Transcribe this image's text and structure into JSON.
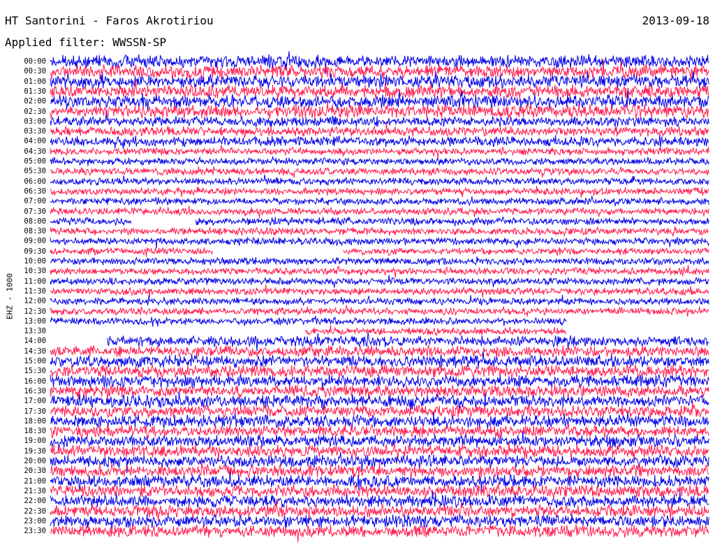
{
  "header": {
    "station": "HT Santorini - Faros Akrotiriou",
    "date": "2013-09-18",
    "filter": "Applied filter: WWSSN-SP"
  },
  "channel": "EHZ - 1000",
  "colors": {
    "trace_a": "#0000e6",
    "trace_b": "#ff1a4d",
    "background": "#ffffff",
    "text": "#000000"
  },
  "chart_data": {
    "type": "line",
    "title": "HT Santorini - Faros Akrotiriou",
    "subtitle": "Applied filter: WWSSN-SP",
    "ylabel": "EHZ - 1000",
    "xlabel": "",
    "row_labels": [
      "00:00",
      "00:30",
      "01:00",
      "01:30",
      "02:00",
      "02:30",
      "03:00",
      "03:30",
      "04:00",
      "04:30",
      "05:00",
      "05:30",
      "06:00",
      "06:30",
      "07:00",
      "07:30",
      "08:00",
      "08:30",
      "09:00",
      "09:30",
      "10:00",
      "10:30",
      "11:00",
      "11:30",
      "12:00",
      "12:30",
      "13:00",
      "13:30",
      "14:00",
      "14:30",
      "15:00",
      "15:30",
      "16:00",
      "16:30",
      "17:00",
      "17:30",
      "18:00",
      "18:30",
      "19:00",
      "19:30",
      "20:00",
      "20:30",
      "21:00",
      "21:30",
      "22:00",
      "22:30",
      "23:00",
      "23:30"
    ],
    "row_colors": [
      "blue",
      "red"
    ],
    "gaps": [
      {
        "row": "08:00",
        "from_min": 3.7,
        "to_min": 6.6
      },
      {
        "row": "09:30",
        "from_min": 7.4,
        "to_min": 13.3
      },
      {
        "row": "13:00",
        "from_min": 23.5,
        "to_min": 30
      },
      {
        "row": "13:30",
        "from_min": 0,
        "to_min": 11.6
      },
      {
        "row": "13:30",
        "from_min": 23.5,
        "to_min": 30
      },
      {
        "row": "14:00",
        "from_min": 0,
        "to_min": 2.6
      }
    ],
    "legend": "none",
    "grid": false
  }
}
